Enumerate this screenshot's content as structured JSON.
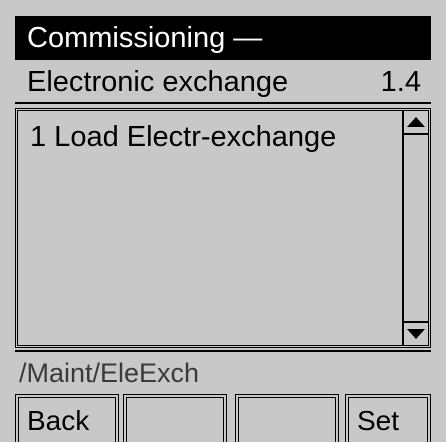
{
  "header": {
    "title": "Commissioning —"
  },
  "subheader": {
    "label": "Electronic exchange",
    "number": "1.4"
  },
  "list": {
    "items": [
      {
        "label": "1 Load Electr-exchange"
      }
    ]
  },
  "path": "/Maint/EleExch",
  "softkeys": {
    "k1": "Back",
    "k2": "",
    "k3": "",
    "k4": "Set"
  },
  "icons": {
    "scroll_up": "scroll-up-arrow-icon",
    "scroll_down": "scroll-down-arrow-icon"
  },
  "colors": {
    "background": "#c8c8c8",
    "title_bar": "#000000",
    "title_text": "#ffffff",
    "path_text": "#3a3a3a"
  }
}
